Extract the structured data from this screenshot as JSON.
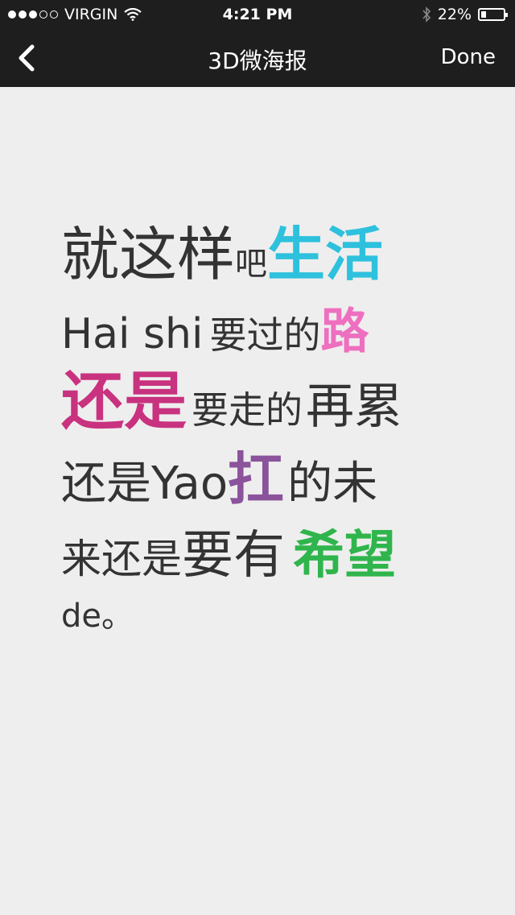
{
  "status_bar": {
    "carrier": "VIRGIN",
    "time": "4:21 PM",
    "battery": "22%",
    "battery_level": 0.22,
    "signal_icon": "signal-dots-icon",
    "wifi_icon": "wifi-icon",
    "bluetooth_icon": "bluetooth-icon"
  },
  "nav": {
    "back_icon": "chevron-left-icon",
    "title": "3D微海报",
    "done_label": "Done"
  },
  "poster": {
    "colors": {
      "text": "#333333",
      "cyan": "#2ec1dd",
      "pink": "#ee6fbf",
      "magenta": "#c8327f",
      "purple": "#8a539b",
      "green": "#2fb54c"
    },
    "line1": [
      "就这样",
      "吧",
      "生活"
    ],
    "line2": [
      "Hai shi",
      "要过的",
      "路"
    ],
    "line3": [
      "还是",
      "要走的",
      "再累"
    ],
    "line4": [
      "还是Yao",
      "扛",
      "的未"
    ],
    "line5": [
      "来还是",
      "要有",
      "希望"
    ],
    "line6": [
      "de。"
    ]
  }
}
